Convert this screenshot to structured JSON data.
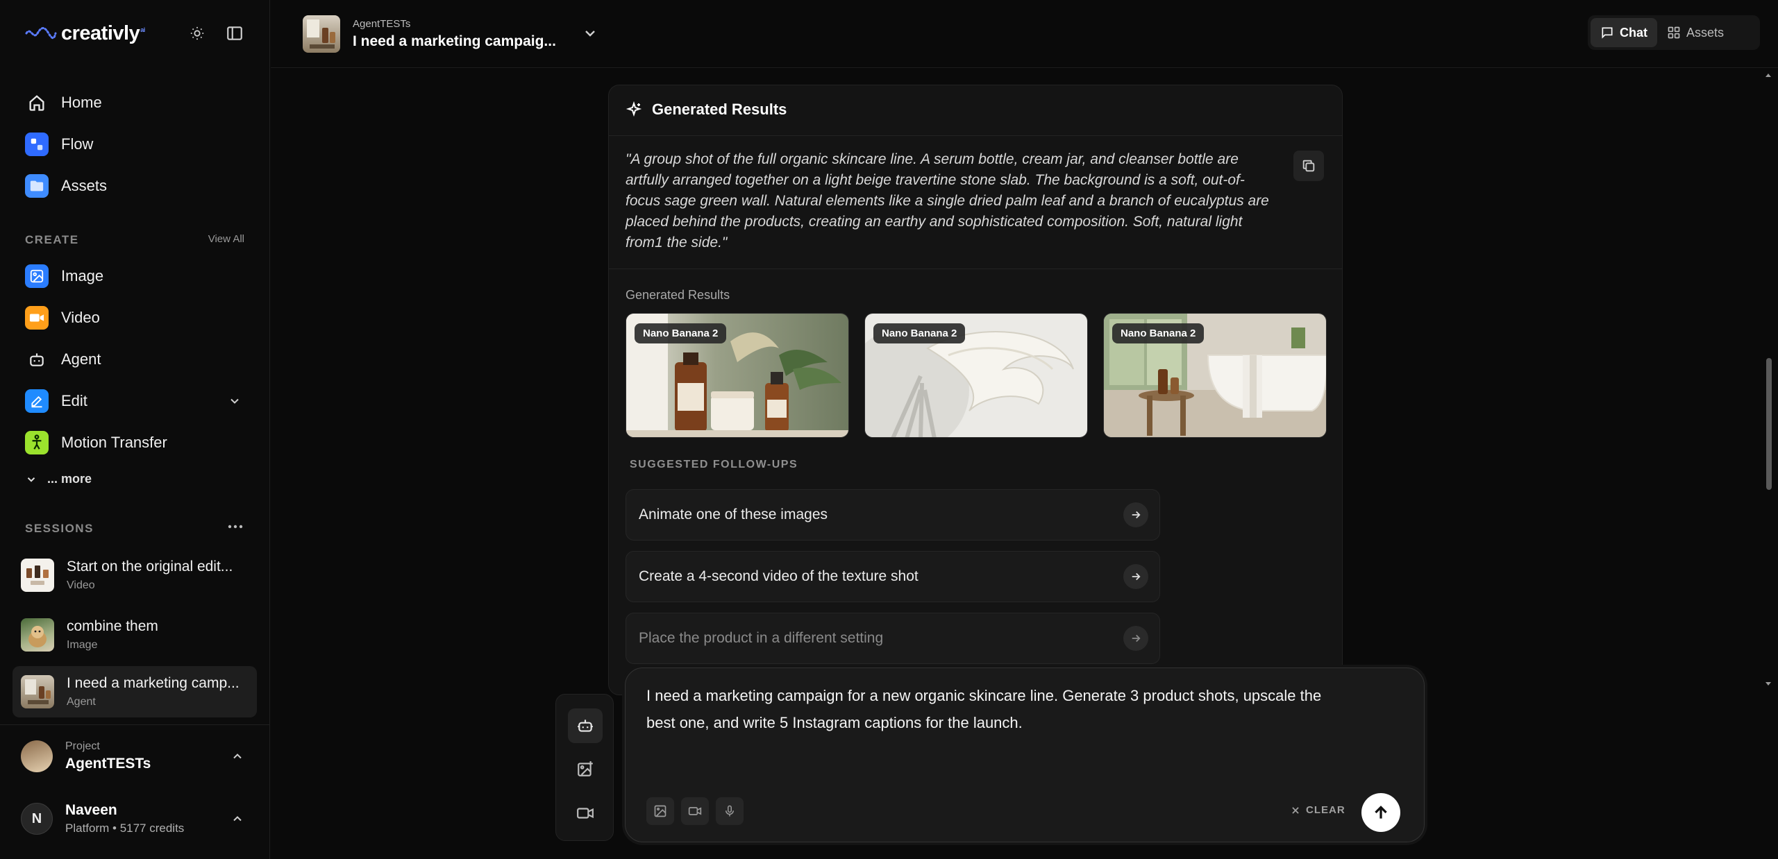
{
  "app": {
    "name": "creativly",
    "name_suffix": "ai"
  },
  "sidebar": {
    "nav": [
      {
        "label": "Home",
        "icon": "home-icon"
      },
      {
        "label": "Flow",
        "icon": "flow-icon"
      },
      {
        "label": "Assets",
        "icon": "folder-icon"
      }
    ],
    "create_heading": "CREATE",
    "view_all": "View All",
    "create_items": [
      {
        "label": "Image",
        "icon": "image-icon"
      },
      {
        "label": "Video",
        "icon": "video-icon"
      },
      {
        "label": "Agent",
        "icon": "robot-icon"
      },
      {
        "label": "Edit",
        "icon": "pencil-icon"
      },
      {
        "label": "Motion Transfer",
        "icon": "figure-icon"
      }
    ],
    "more_label": "... more",
    "sessions_heading": "SESSIONS",
    "sessions": [
      {
        "title": "Start on the original edit...",
        "type": "Video"
      },
      {
        "title": "combine them",
        "type": "Image"
      },
      {
        "title": "I need a marketing camp...",
        "type": "Agent"
      }
    ],
    "project": {
      "label": "Project",
      "name": "AgentTESTs"
    },
    "user": {
      "initial": "N",
      "name": "Naveen",
      "plan": "Platform • 5177 credits"
    }
  },
  "topbar": {
    "project_label": "AgentTESTs",
    "title": "I need a marketing campaig...",
    "tabs": [
      {
        "label": "Chat",
        "active": true
      },
      {
        "label": "Assets",
        "active": false
      }
    ]
  },
  "results": {
    "heading": "Generated Results",
    "prompt": "\"A group shot of the full organic skincare line. A serum bottle, cream jar, and cleanser bottle are artfully arranged together on a light beige travertine stone slab. The background is a soft, out-of-focus sage green wall. Natural elements like a single dried palm leaf and a branch of eucalyptus are placed behind the products, creating an earthy and sophisticated composition. Soft, natural light from1 the side.\"",
    "images_label": "Generated Results",
    "images": [
      {
        "badge": "Nano Banana 2"
      },
      {
        "badge": "Nano Banana 2"
      },
      {
        "badge": "Nano Banana 2"
      }
    ],
    "followups_heading": "SUGGESTED FOLLOW-UPS",
    "followups": [
      "Animate one of these images",
      "Create a 4-second video of the texture shot",
      "Place the product in a different setting"
    ]
  },
  "composer": {
    "text": "I need a marketing campaign for a new organic skincare line. Generate 3 product shots, upscale the best one, and write 5 Instagram captions for the launch.",
    "clear_label": "CLEAR"
  },
  "colors": {
    "accent_blue": "#2f6bff",
    "video_orange": "#ff9f1a",
    "motion_lime": "#9be22d"
  }
}
